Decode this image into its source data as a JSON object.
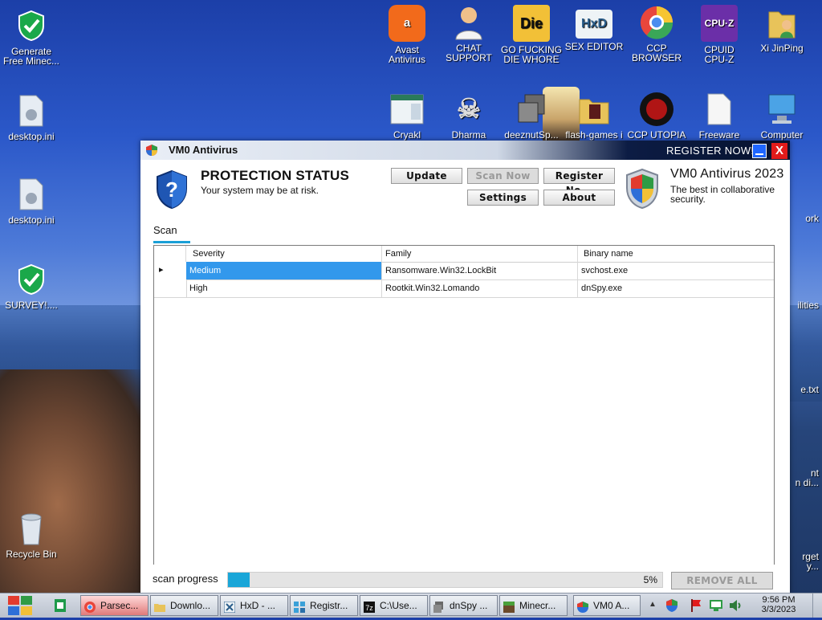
{
  "desktop": {
    "icons": [
      {
        "label": "Generate\nFree Minec...",
        "glyph": "✓",
        "icon": "shield-check-icon",
        "color": "#1aa84a"
      },
      {
        "label": "desktop.ini",
        "glyph": "⚙",
        "icon": "settings-file-icon",
        "color": "#c9d3e0"
      },
      {
        "label": "desktop.ini",
        "glyph": "⚙",
        "icon": "settings-file-icon",
        "color": "#c9d3e0"
      },
      {
        "label": "SURVEY!....",
        "glyph": "✓",
        "icon": "shield-check-icon",
        "color": "#1aa84a"
      },
      {
        "label": "Recycle Bin",
        "glyph": "🗑",
        "icon": "recycle-bin-icon",
        "color": "#c9d3e0"
      },
      {
        "label": "Avast\nAntivirus",
        "glyph": "a",
        "icon": "avast-icon",
        "color": "#f26a1b"
      },
      {
        "label": "CHAT\nSUPPORT",
        "glyph": "☻",
        "icon": "support-person-icon",
        "color": "#f0c08a"
      },
      {
        "label": "GO FUCKING\nDIE WHORE",
        "glyph": "Die",
        "icon": "die-app-icon",
        "color": "#f2c037"
      },
      {
        "label": "SEX EDITOR",
        "glyph": "HxD",
        "icon": "hxd-icon",
        "color": "#dfe8ef"
      },
      {
        "label": "CCP\nBROWSER",
        "glyph": "●",
        "icon": "chrome-browser-icon",
        "color": "#e8463c"
      },
      {
        "label": "CPUID\nCPU-Z",
        "glyph": "CPU",
        "icon": "cpuz-icon",
        "color": "#6b2fa8"
      },
      {
        "label": "Xi JinPing",
        "glyph": "📁",
        "icon": "user-folder-icon",
        "color": "#e8c35a"
      },
      {
        "label": "Cryakl",
        "glyph": "▤",
        "icon": "program-window-icon",
        "color": "#dfe8ef"
      },
      {
        "label": "Dharma",
        "glyph": "☠",
        "icon": "skull-icon",
        "color": "#cfcfcf"
      },
      {
        "label": "deeznutSp...",
        "glyph": "❐",
        "icon": "copy-files-icon",
        "color": "#8a8a8a"
      },
      {
        "label": "flash-games i",
        "glyph": "📁",
        "icon": "folder-icon",
        "color": "#e8c35a"
      },
      {
        "label": "CCP UTOPIA",
        "glyph": "◉",
        "icon": "utopia-icon",
        "color": "#b01515"
      },
      {
        "label": "Freeware",
        "glyph": "📄",
        "icon": "document-icon",
        "color": "#f2f2f2"
      },
      {
        "label": "Computer",
        "glyph": "🖥",
        "icon": "computer-icon",
        "color": "#4ba3e6"
      },
      {
        "label": "ork",
        "glyph": "🖥",
        "icon": "network-icon",
        "color": "#4ba3e6"
      },
      {
        "label": "ilities",
        "glyph": "◐",
        "icon": "utilities-icon",
        "color": "#3a7fc0"
      },
      {
        "label": "e.txt",
        "glyph": "📄",
        "icon": "text-file-icon",
        "color": "#f2f2f2"
      },
      {
        "label": "nt\nn di...",
        "glyph": "🖨",
        "icon": "printer-icon",
        "color": "#d0d0d0"
      },
      {
        "label": "rget\ny...",
        "glyph": "📄",
        "icon": "target-file-icon",
        "color": "#f2f2f2"
      }
    ]
  },
  "window": {
    "title": "VM0 Antivirus",
    "register_now": "REGISTER NOW!",
    "close_label": "X",
    "status_title": "PROTECTION STATUS",
    "status_sub": "Your system may be at risk.",
    "buttons": {
      "update": "Update",
      "scan_now": "Scan Now",
      "register": "Register No...",
      "settings": "Settings",
      "about": "About"
    },
    "brand": "VM0 Antivirus 2023",
    "brand_sub": "The best in collaborative\nsecurity.",
    "tab": "Scan",
    "grid": {
      "columns": [
        "Severity",
        "Family",
        "Binary name"
      ],
      "rows": [
        {
          "severity": "Medium",
          "family": "Ransomware.Win32.LockBit",
          "binary": "svchost.exe",
          "marker": "▸"
        },
        {
          "severity": "High",
          "family": "Rootkit.Win32.Lomando",
          "binary": "dnSpy.exe",
          "marker": ""
        }
      ]
    },
    "scan_progress_label": "scan progress",
    "progress_pct": "5%",
    "progress_value": 0.05,
    "remove_all": "REMOVE ALL TH..."
  },
  "taskbar": {
    "items": [
      {
        "label": "Parsec...",
        "icon": "chrome-icon",
        "active": true
      },
      {
        "label": "Downlo...",
        "icon": "folder-icon",
        "active": false
      },
      {
        "label": "HxD - ...",
        "icon": "hxd-icon",
        "active": false
      },
      {
        "label": "Registr...",
        "icon": "registry-icon",
        "active": false
      },
      {
        "label": "C:\\Use...",
        "icon": "7zip-icon",
        "active": false
      },
      {
        "label": "dnSpy ...",
        "icon": "dnspy-icon",
        "active": false
      },
      {
        "label": "Minecr...",
        "icon": "minecraft-icon",
        "active": false
      },
      {
        "label": "VM0 A...",
        "icon": "vm0-icon",
        "active": false
      }
    ],
    "time": "9:56 PM",
    "date": "3/3/2023"
  }
}
